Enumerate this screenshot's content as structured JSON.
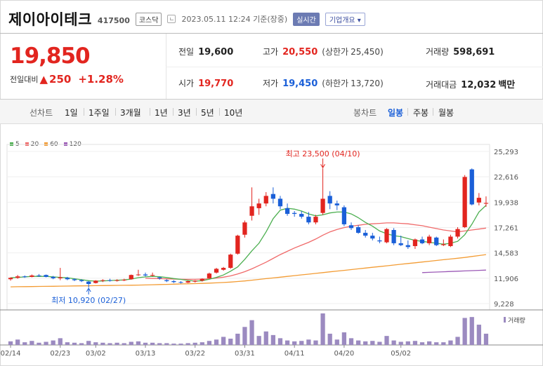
{
  "header": {
    "name": "제이아이테크",
    "code": "417500",
    "market": "코스닥",
    "datetime": "2023.05.11 12:24 기준(장중)",
    "realtime_label": "실시간",
    "overview_label": "기업개요 ▾"
  },
  "price": {
    "current": "19,850",
    "change_label": "전일대비",
    "change_arrow": "▲",
    "change": "250",
    "change_pct": "+1.28%"
  },
  "summary": {
    "prev_close_label": "전일",
    "prev_close": "19,600",
    "high_label": "고가",
    "high": "20,550",
    "upper_limit_label": "(상한가",
    "upper_limit": "25,450)",
    "volume_label": "거래량",
    "volume": "598,691",
    "open_label": "시가",
    "open": "19,770",
    "low_label": "저가",
    "low": "19,450",
    "lower_limit_label": "(하한가",
    "lower_limit": "13,720)",
    "amount_label": "거래대금",
    "amount": "12,032",
    "amount_unit": "백만"
  },
  "period_bar": {
    "line_label": "선차트",
    "line_items": [
      "1일",
      "1주일",
      "3개월",
      "1년",
      "3년",
      "5년",
      "10년"
    ],
    "candle_label": "봉차트",
    "candle_items": [
      "일봉",
      "주봉",
      "월봉"
    ],
    "selected": "일봉"
  },
  "colors": {
    "up": "#e2251f",
    "down": "#1a5fd8",
    "ma5": "#4caf50",
    "ma20": "#f06a6a",
    "ma60": "#f39c34",
    "ma120": "#9b59b6",
    "volume": "#9b8ac0"
  },
  "chart_data": {
    "type": "candlestick",
    "legend": [
      {
        "name": "5",
        "color": "#4caf50"
      },
      {
        "name": "20",
        "color": "#f06a6a"
      },
      {
        "name": "60",
        "color": "#f39c34"
      },
      {
        "name": "120",
        "color": "#9b59b6"
      }
    ],
    "y_ticks": [
      "25,293",
      "22,616",
      "19,938",
      "17,261",
      "14,583",
      "11,906",
      "9,228"
    ],
    "ylim": [
      9228,
      25293
    ],
    "x_ticks": [
      "02/14",
      "02/23",
      "03/02",
      "03/13",
      "03/22",
      "03/31",
      "04/11",
      "04/20",
      "05/02"
    ],
    "annotations": {
      "high": {
        "label": "최고 23,500 (04/10)",
        "value": 23500
      },
      "low": {
        "label": "최저 10,920 (02/27)",
        "value": 10920
      }
    },
    "volume_label": "거래량",
    "candles": [
      [
        11800,
        12000,
        11650,
        11950
      ],
      [
        11950,
        12250,
        11850,
        12100
      ],
      [
        12100,
        12200,
        11950,
        12050
      ],
      [
        12050,
        12300,
        12000,
        12200
      ],
      [
        12200,
        12350,
        12050,
        12150
      ],
      [
        12250,
        12300,
        12000,
        12050
      ],
      [
        12050,
        12150,
        11800,
        11900
      ],
      [
        11900,
        13000,
        11700,
        12000
      ],
      [
        11950,
        12050,
        11700,
        11800
      ],
      [
        11800,
        11900,
        11600,
        11700
      ],
      [
        11700,
        11800,
        11500,
        11600
      ],
      [
        11550,
        11600,
        10920,
        11300
      ],
      [
        11400,
        11700,
        11350,
        11650
      ],
      [
        11650,
        11800,
        11500,
        11700
      ],
      [
        11700,
        11850,
        11550,
        11650
      ],
      [
        11650,
        11800,
        11550,
        11700
      ],
      [
        11700,
        11850,
        11600,
        11750
      ],
      [
        11800,
        12300,
        11750,
        12250
      ],
      [
        12300,
        12800,
        12150,
        12300
      ],
      [
        12300,
        12500,
        12100,
        12200
      ],
      [
        12200,
        12500,
        12100,
        12250
      ],
      [
        12000,
        12050,
        11750,
        11900
      ],
      [
        11700,
        11800,
        11500,
        11600
      ],
      [
        11600,
        11700,
        11400,
        11500
      ],
      [
        11500,
        11600,
        11350,
        11450
      ],
      [
        11450,
        11650,
        11400,
        11600
      ],
      [
        11550,
        11700,
        11450,
        11650
      ],
      [
        11650,
        11900,
        11550,
        11850
      ],
      [
        11900,
        12500,
        11850,
        12400
      ],
      [
        12500,
        13000,
        12400,
        12900
      ],
      [
        12800,
        13100,
        12700,
        13000
      ],
      [
        13000,
        14500,
        12900,
        14400
      ],
      [
        14500,
        16500,
        14400,
        16400
      ],
      [
        16500,
        18000,
        16200,
        17800
      ],
      [
        18500,
        21500,
        18000,
        19500
      ],
      [
        19300,
        20300,
        18600,
        19800
      ],
      [
        19800,
        21000,
        19500,
        20600
      ],
      [
        20800,
        21500,
        19800,
        20300
      ],
      [
        20300,
        20600,
        19200,
        19500
      ],
      [
        19300,
        19800,
        18500,
        18700
      ],
      [
        18800,
        19000,
        18400,
        18700
      ],
      [
        18700,
        19000,
        18200,
        18400
      ],
      [
        18400,
        18900,
        17600,
        17800
      ],
      [
        17800,
        18600,
        17600,
        18400
      ],
      [
        18800,
        23500,
        18600,
        20300
      ],
      [
        20600,
        21100,
        19200,
        19800
      ],
      [
        19800,
        20100,
        19100,
        19600
      ],
      [
        19400,
        19600,
        17400,
        17600
      ],
      [
        17500,
        17800,
        17000,
        17200
      ],
      [
        17300,
        17500,
        16600,
        16700
      ],
      [
        16700,
        17000,
        16200,
        16400
      ],
      [
        16400,
        16700,
        15900,
        16100
      ],
      [
        15900,
        16300,
        15600,
        15800
      ],
      [
        15700,
        17200,
        15600,
        17100
      ],
      [
        17000,
        17200,
        15400,
        15600
      ],
      [
        15600,
        16400,
        15300,
        15400
      ],
      [
        15400,
        15900,
        15000,
        15200
      ],
      [
        15300,
        16100,
        15000,
        16000
      ],
      [
        16000,
        16300,
        15500,
        15600
      ],
      [
        15600,
        16500,
        15400,
        16300
      ],
      [
        16200,
        16300,
        15300,
        15400
      ],
      [
        15400,
        16000,
        15300,
        15500
      ],
      [
        15300,
        16500,
        15200,
        16300
      ],
      [
        16300,
        17300,
        16100,
        17100
      ],
      [
        17300,
        22800,
        17200,
        22600
      ],
      [
        23400,
        23500,
        19600,
        19700
      ],
      [
        19900,
        20900,
        19600,
        20400
      ],
      [
        19770,
        20550,
        19450,
        19850
      ]
    ],
    "ma5": [
      11950,
      12000,
      12050,
      12100,
      12100,
      12100,
      12050,
      12000,
      11950,
      11850,
      11750,
      11650,
      11600,
      11620,
      11660,
      11700,
      11720,
      11820,
      11970,
      12050,
      12100,
      12060,
      11980,
      11870,
      11780,
      11680,
      11600,
      11650,
      11800,
      12000,
      12250,
      12650,
      13100,
      13900,
      14800,
      15600,
      16800,
      18200,
      19100,
      19300,
      19200,
      19000,
      18700,
      18500,
      18600,
      18800,
      18900,
      18900,
      18700,
      18300,
      17800,
      17400,
      16900,
      16600,
      16400,
      16300,
      16100,
      15900,
      15800,
      15700,
      15600,
      15500,
      15600,
      15800,
      16500,
      17600,
      18900,
      19600
    ],
    "ma20": [
      null,
      null,
      null,
      null,
      null,
      null,
      null,
      null,
      null,
      null,
      null,
      null,
      null,
      null,
      null,
      null,
      null,
      null,
      null,
      11900,
      11880,
      11860,
      11840,
      11820,
      11800,
      11790,
      11790,
      11810,
      11850,
      11920,
      12020,
      12150,
      12350,
      12600,
      12900,
      13250,
      13600,
      14000,
      14400,
      14750,
      15100,
      15400,
      15700,
      16050,
      16450,
      16800,
      17050,
      17250,
      17400,
      17500,
      17600,
      17650,
      17700,
      17750,
      17750,
      17700,
      17650,
      17550,
      17450,
      17300,
      17150,
      17000,
      16900,
      16800,
      16900,
      17000,
      17100,
      17200
    ],
    "ma60": [
      11000,
      11010,
      11020,
      11030,
      11040,
      11050,
      11060,
      11070,
      11080,
      11090,
      11100,
      11110,
      11120,
      11130,
      11140,
      11150,
      11160,
      11170,
      11185,
      11200,
      11220,
      11240,
      11260,
      11280,
      11300,
      11320,
      11340,
      11360,
      11390,
      11420,
      11460,
      11500,
      11560,
      11620,
      11700,
      11780,
      11860,
      11940,
      12020,
      12100,
      12180,
      12260,
      12340,
      12420,
      12500,
      12580,
      12660,
      12740,
      12820,
      12900,
      12980,
      13060,
      13140,
      13220,
      13300,
      13380,
      13460,
      13540,
      13620,
      13700,
      13780,
      13860,
      13940,
      14020,
      14100,
      14200,
      14300,
      14400
    ],
    "ma120": [
      null,
      null,
      null,
      null,
      null,
      null,
      null,
      null,
      null,
      null,
      null,
      null,
      null,
      null,
      null,
      null,
      null,
      null,
      null,
      null,
      null,
      null,
      null,
      null,
      null,
      null,
      null,
      null,
      null,
      null,
      null,
      null,
      null,
      null,
      null,
      null,
      null,
      null,
      null,
      null,
      null,
      null,
      null,
      null,
      null,
      null,
      null,
      null,
      null,
      null,
      null,
      null,
      null,
      null,
      null,
      null,
      null,
      null,
      12500,
      12530,
      12560,
      12590,
      12620,
      12650,
      12680,
      12710,
      12740,
      12770
    ],
    "volumes": [
      8,
      12,
      6,
      9,
      5,
      7,
      10,
      15,
      6,
      5,
      4,
      9,
      6,
      5,
      4,
      5,
      4,
      7,
      8,
      5,
      5,
      4,
      4,
      3,
      3,
      4,
      5,
      6,
      9,
      12,
      18,
      14,
      25,
      40,
      55,
      20,
      30,
      22,
      15,
      10,
      8,
      9,
      12,
      10,
      70,
      25,
      12,
      28,
      15,
      10,
      8,
      9,
      7,
      20,
      10,
      7,
      8,
      9,
      6,
      8,
      6,
      6,
      10,
      18,
      60,
      62,
      45,
      25
    ]
  }
}
